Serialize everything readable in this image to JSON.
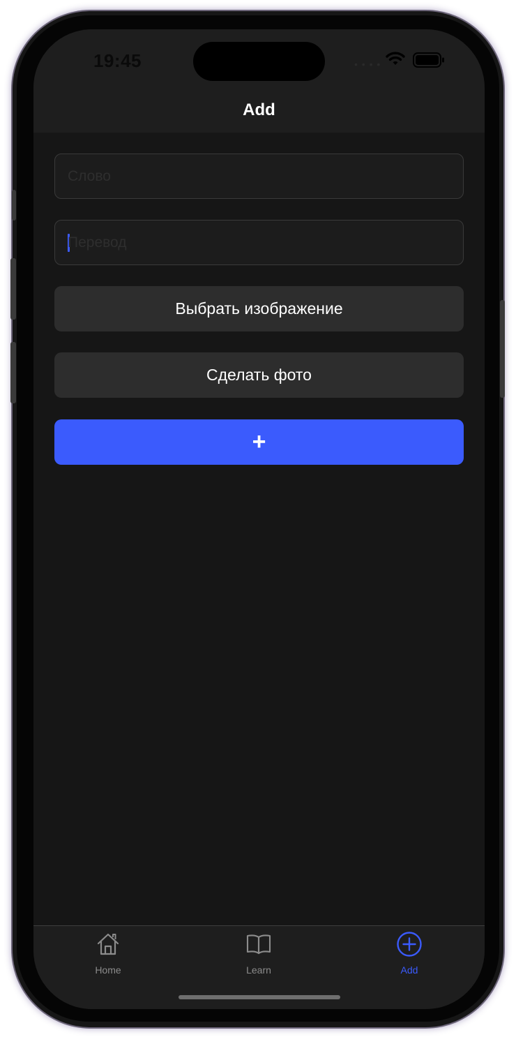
{
  "status_bar": {
    "time": "19:45",
    "icons": [
      "cellular-dots-icon",
      "wifi-icon",
      "battery-icon"
    ],
    "signal_glyph": "• • • •"
  },
  "nav": {
    "title": "Add"
  },
  "form": {
    "word_field": {
      "value": "",
      "placeholder": "Слово"
    },
    "translation_field": {
      "value": "",
      "placeholder": "Перевод",
      "focused": true
    },
    "choose_image_label": "Выбрать изображение",
    "take_photo_label": "Сделать фото",
    "add_label": "+"
  },
  "tab_bar": {
    "tabs": [
      {
        "label": "Home",
        "icon": "house-icon",
        "active": false
      },
      {
        "label": "Learn",
        "icon": "book-icon",
        "active": false
      },
      {
        "label": "Add",
        "icon": "plus-circle-icon",
        "active": true
      }
    ]
  },
  "colors": {
    "accent": "#3b5bfd",
    "background": "#161616",
    "bar_background": "#1e1e1e",
    "button_background": "#2d2d2d",
    "inactive_tab": "#8c8c8c"
  }
}
